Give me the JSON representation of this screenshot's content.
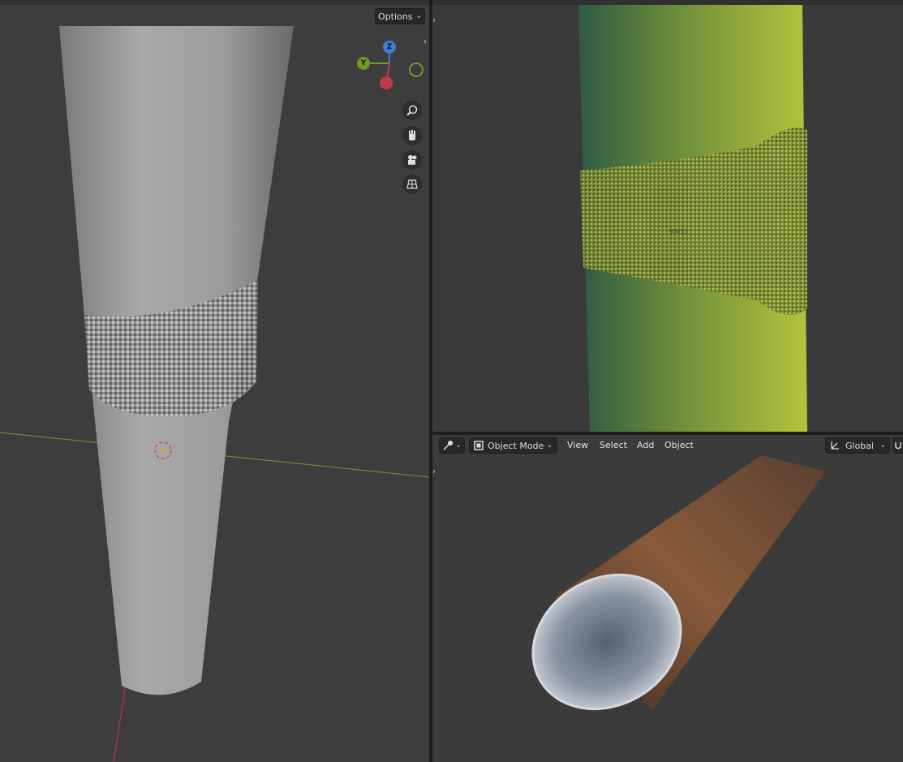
{
  "left_viewport": {
    "options_label": "Options",
    "gizmo": {
      "z_label": "Z",
      "y_label": "Y"
    },
    "nav_icons": [
      "zoom-icon",
      "hand-pan-icon",
      "camera-icon",
      "perspective-grid-icon"
    ],
    "colors": {
      "x_axis": "#c23a4a",
      "y_axis": "#6f9a2a",
      "z_axis": "#3c7fd6"
    }
  },
  "top_right_viewport": {
    "band_text": "CUBA",
    "colors": {
      "shading_light": "#b5c23c",
      "shading_dark": "#2f5a44"
    }
  },
  "bottom_right_viewport": {
    "header": {
      "editor_icon": "editor-type-icon",
      "mode_label": "Object Mode",
      "menu": [
        "View",
        "Select",
        "Add",
        "Object"
      ],
      "orientation_label": "Global"
    },
    "colors": {
      "shading": "#8a5a3a"
    }
  }
}
